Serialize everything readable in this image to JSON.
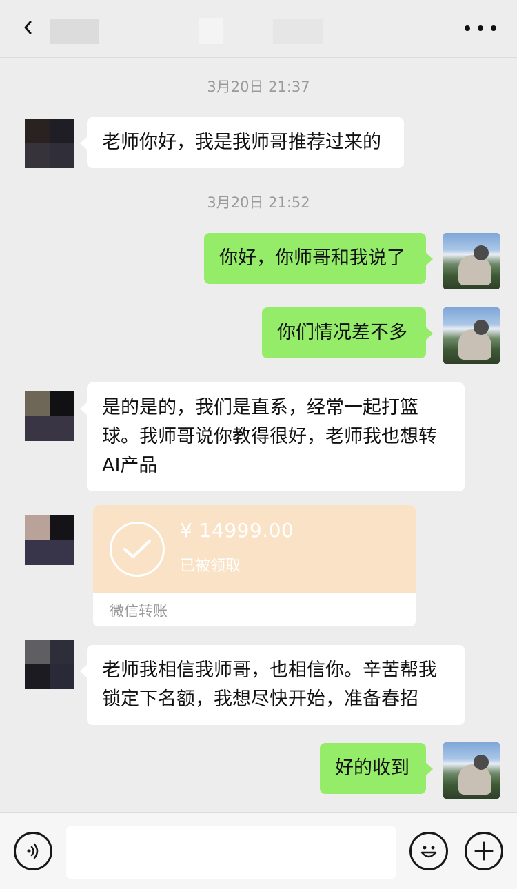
{
  "header": {
    "back_icon": "chevron-left-icon",
    "more_icon": "more-dots-icon"
  },
  "timestamps": [
    "3月20日 21:37",
    "3月20日 21:52"
  ],
  "messages": [
    {
      "side": "left",
      "text": "老师你好，我是我师哥推荐过来的"
    },
    {
      "side": "right",
      "text": "你好，你师哥和我说了"
    },
    {
      "side": "right",
      "text": "你们情况差不多"
    },
    {
      "side": "left",
      "text": "是的是的，我们是直系，经常一起打篮球。我师哥说你教得很好，老师我也想转AI产品"
    },
    {
      "side": "left",
      "text": "老师我相信我师哥，也相信你。辛苦帮我锁定下名额，我想尽快开始，准备春招"
    },
    {
      "side": "right",
      "text": "好的收到"
    }
  ],
  "transfer": {
    "amount": "¥ 14999.00",
    "status": "已被领取",
    "label": "微信转账",
    "icon": "check-circle-icon",
    "color": "#fae2c7"
  },
  "colors": {
    "background": "#ededed",
    "my_bubble": "#95ec69",
    "their_bubble": "#ffffff",
    "timestamp": "#9a9a9a"
  },
  "input_bar": {
    "voice_icon": "voice-icon",
    "emoji_icon": "emoji-icon",
    "plus_icon": "plus-icon",
    "placeholder": ""
  }
}
